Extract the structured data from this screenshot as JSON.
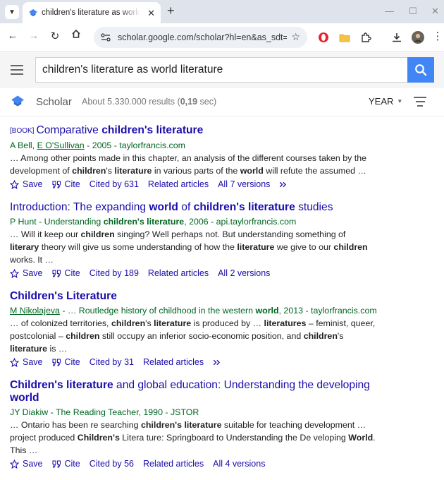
{
  "browser": {
    "tab_title": "children's literature as world literature - Google Scholar",
    "url": "scholar.google.com/scholar?hl=en&as_sdt=...",
    "colors": {
      "tabbar": "#dfe3eb",
      "omnibox": "#edf0f5"
    }
  },
  "scholar": {
    "query": "children's literature as world literature",
    "brand": "Scholar",
    "results_summary": "About 5.330.000 results (",
    "results_time": "0,19",
    "results_time_suffix": " sec)",
    "year_label": "YEAR",
    "colors": {
      "link": "#1a0dab",
      "authors": "#006621",
      "search_button": "#4285f4"
    }
  },
  "results": [
    {
      "tag": "[BOOK]",
      "title_parts": [
        {
          "t": "Comparative ",
          "b": false
        },
        {
          "t": "children's literature",
          "b": true
        }
      ],
      "authors_parts": [
        {
          "t": "A Bell, ",
          "u": false
        },
        {
          "t": "E O'Sullivan",
          "u": true
        },
        {
          "t": " - 2005 - taylorfrancis.com",
          "u": false
        }
      ],
      "snippet_parts": [
        {
          "t": "… Among other points made in this chapter, an analysis of the different courses taken by the development of ",
          "b": false
        },
        {
          "t": "children",
          "b": true
        },
        {
          "t": "'s ",
          "b": false
        },
        {
          "t": "literature",
          "b": true
        },
        {
          "t": " in various parts of the ",
          "b": false
        },
        {
          "t": "world",
          "b": true
        },
        {
          "t": " will refute the assumed …",
          "b": false
        }
      ],
      "actions": {
        "save": "Save",
        "cite": "Cite",
        "cited_by": "Cited by 631",
        "related": "Related articles",
        "versions": "All 7 versions",
        "more": true
      }
    },
    {
      "tag": "",
      "title_parts": [
        {
          "t": "Introduction: The expanding ",
          "b": false
        },
        {
          "t": "world",
          "b": true
        },
        {
          "t": " of ",
          "b": false
        },
        {
          "t": "children's literature",
          "b": true
        },
        {
          "t": " studies",
          "b": false
        }
      ],
      "authors_parts": [
        {
          "t": "P Hunt - Understanding ",
          "u": false,
          "b": false
        },
        {
          "t": "children's literature",
          "u": false,
          "b": true
        },
        {
          "t": ", 2006 - api.taylorfrancis.com",
          "u": false,
          "b": false
        }
      ],
      "snippet_parts": [
        {
          "t": "… Will it keep our ",
          "b": false
        },
        {
          "t": "children",
          "b": true
        },
        {
          "t": " singing? Well perhaps not. But understanding something of ",
          "b": false
        },
        {
          "t": "literary",
          "b": true
        },
        {
          "t": " theory will give us some understanding of how the ",
          "b": false
        },
        {
          "t": "literature",
          "b": true
        },
        {
          "t": " we give to our ",
          "b": false
        },
        {
          "t": "children",
          "b": true
        },
        {
          "t": " works. It …",
          "b": false
        }
      ],
      "actions": {
        "save": "Save",
        "cite": "Cite",
        "cited_by": "Cited by 189",
        "related": "Related articles",
        "versions": "All 2 versions",
        "more": false
      }
    },
    {
      "tag": "",
      "title_parts": [
        {
          "t": "Children's Literature",
          "b": true
        }
      ],
      "authors_parts": [
        {
          "t": "M Nikolajeva",
          "u": true,
          "b": false
        },
        {
          "t": " - … Routledge history of childhood in the western ",
          "u": false,
          "b": false
        },
        {
          "t": "world",
          "u": false,
          "b": true
        },
        {
          "t": ", 2013 - taylorfrancis.com",
          "u": false,
          "b": false
        }
      ],
      "snippet_parts": [
        {
          "t": "… of colonized territories, ",
          "b": false
        },
        {
          "t": "children",
          "b": true
        },
        {
          "t": "'s ",
          "b": false
        },
        {
          "t": "literature",
          "b": true
        },
        {
          "t": " is produced by … ",
          "b": false
        },
        {
          "t": "literatures",
          "b": true
        },
        {
          "t": " – feminist, queer, postcolonial – ",
          "b": false
        },
        {
          "t": "children",
          "b": true
        },
        {
          "t": " still occupy an inferior socio-economic position, and ",
          "b": false
        },
        {
          "t": "children",
          "b": true
        },
        {
          "t": "'s ",
          "b": false
        },
        {
          "t": "literature",
          "b": true
        },
        {
          "t": " is …",
          "b": false
        }
      ],
      "actions": {
        "save": "Save",
        "cite": "Cite",
        "cited_by": "Cited by 31",
        "related": "Related articles",
        "versions": "",
        "more": true
      }
    },
    {
      "tag": "",
      "title_parts": [
        {
          "t": "Children's literature",
          "b": true
        },
        {
          "t": " and global education: Understanding the developing ",
          "b": false
        },
        {
          "t": "world",
          "b": true
        }
      ],
      "authors_parts": [
        {
          "t": "JY Diakiw - The Reading Teacher, 1990 - JSTOR",
          "u": false,
          "b": false
        }
      ],
      "snippet_parts": [
        {
          "t": "… Ontario has been re searching ",
          "b": false
        },
        {
          "t": "children's literature",
          "b": true
        },
        {
          "t": " suitable for teaching development … project produced ",
          "b": false
        },
        {
          "t": "Children's",
          "b": true
        },
        {
          "t": " Litera ture: Springboard to Understanding the De veloping ",
          "b": false
        },
        {
          "t": "World",
          "b": true
        },
        {
          "t": ". This …",
          "b": false
        }
      ],
      "actions": {
        "save": "Save",
        "cite": "Cite",
        "cited_by": "Cited by 56",
        "related": "Related articles",
        "versions": "All 4 versions",
        "more": false
      }
    }
  ]
}
